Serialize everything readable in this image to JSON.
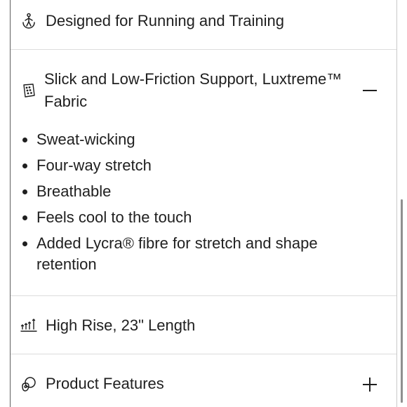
{
  "sections": [
    {
      "label": "Designed for Running and Training",
      "icon": "running-person-icon",
      "expanded": false
    },
    {
      "label": "Slick and Low-Friction Support, Luxtreme™ Fabric",
      "icon": "fabric-swatch-icon",
      "expanded": true,
      "toggle_icon": "minus-icon",
      "details": [
        "Sweat-wicking",
        "Four-way stretch",
        "Breathable",
        "Feels cool to the touch",
        "Added Lycra® fibre for stretch and shape retention"
      ]
    },
    {
      "label": "High Rise, 23\" Length",
      "icon": "rise-length-icon",
      "expanded": false
    },
    {
      "label": "Product Features",
      "icon": "product-features-icon",
      "expanded": false,
      "toggle_icon": "plus-icon"
    }
  ],
  "colors": {
    "text": "#1f1f1f",
    "divider": "#dcdcdc",
    "background": "#ffffff"
  }
}
